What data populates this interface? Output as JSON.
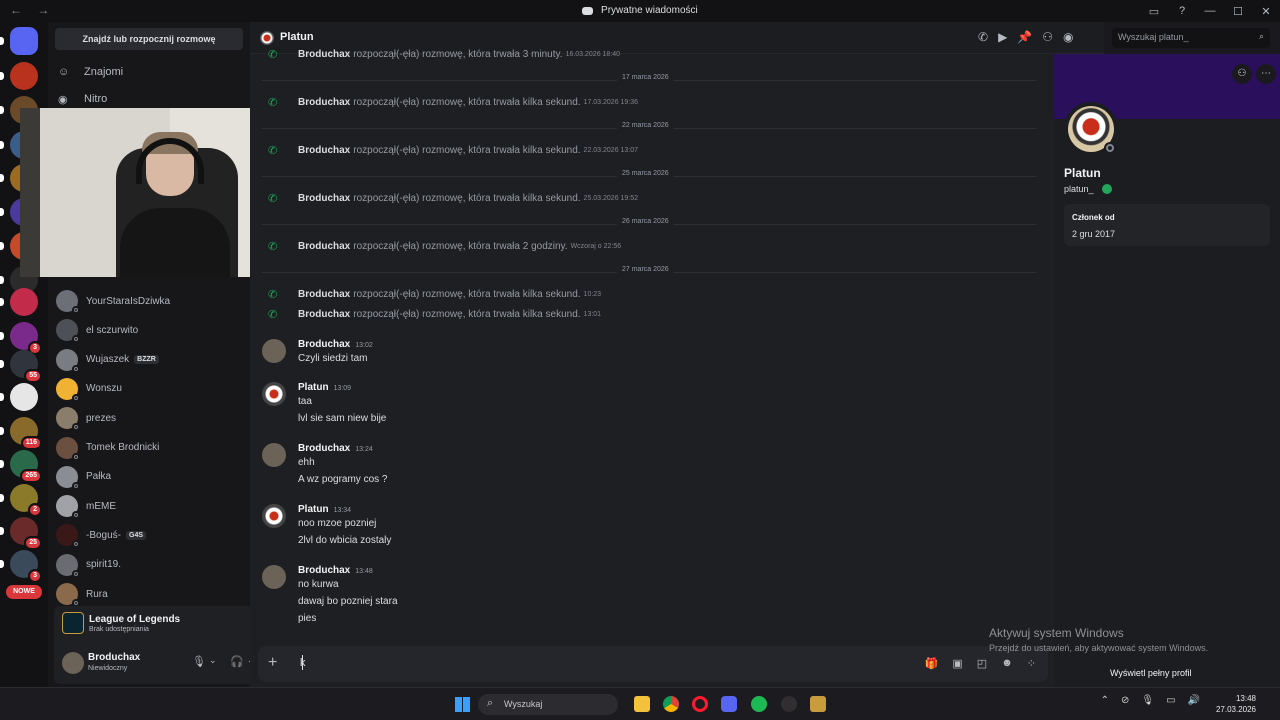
{
  "window": {
    "title": "Prywatne wiadomości",
    "nav_arrows": "← →",
    "minimize": "—",
    "maximize": "☐",
    "close": "✕"
  },
  "servers": [
    {
      "color": "#5865f2",
      "badge": ""
    },
    {
      "color": "#b8321e",
      "badge": ""
    },
    {
      "color": "#6b4a2a",
      "badge": ""
    },
    {
      "color": "#3a5d8a",
      "badge": ""
    },
    {
      "color": "#9a6b21",
      "badge": ""
    },
    {
      "color": "#4a3aa0",
      "badge": ""
    },
    {
      "color": "#c44a2a",
      "badge": ""
    },
    {
      "color": "#2b2b2b",
      "badge": ""
    },
    {
      "color": "#c22b4a",
      "badge": ""
    },
    {
      "color": "#7a2a8a",
      "badge": "3"
    },
    {
      "color": "#30353d",
      "badge": "55"
    },
    {
      "color": "#e6e6e6",
      "badge": ""
    },
    {
      "color": "#8a6a2a",
      "badge": "116"
    },
    {
      "color": "#2a6a4a",
      "badge": "265"
    },
    {
      "color": "#8a7a2a",
      "badge": "2"
    },
    {
      "color": "#6a2a2a",
      "badge": "25"
    },
    {
      "color": "#3a4a5a",
      "badge": "3"
    }
  ],
  "servers_new_label": "NOWE",
  "dm": {
    "search_placeholder": "Znajdź lub rozpocznij rozmowę",
    "nav": [
      {
        "label": "Znajomi",
        "icon": "friends-icon"
      },
      {
        "label": "Nitro",
        "icon": "nitro-icon"
      }
    ],
    "list": [
      {
        "name": "YourStaraIsDziwka",
        "tag": "",
        "color": "#6d6f78"
      },
      {
        "name": "el sczurwito",
        "tag": "",
        "color": "#4e5058"
      },
      {
        "name": "Wujaszek",
        "tag": "BZZR",
        "color": "#7a7c84"
      },
      {
        "name": "Wonszu",
        "tag": "",
        "color": "#f0b232"
      },
      {
        "name": "prezes",
        "tag": "",
        "color": "#8a7d6b"
      },
      {
        "name": "Tomek Brodnicki",
        "tag": "",
        "color": "#6b5040"
      },
      {
        "name": "Pałka",
        "tag": "",
        "color": "#8b8d94"
      },
      {
        "name": "mEME",
        "tag": "",
        "color": "#a0a2a8"
      },
      {
        "name": "-Boguś-",
        "tag": "G4S",
        "color": "#3a1818"
      },
      {
        "name": "spirit19.",
        "tag": "",
        "color": "#6a6c72"
      },
      {
        "name": "Rura",
        "tag": "",
        "color": "#8a6a4a"
      }
    ],
    "activity": {
      "game": "League of Legends",
      "status": "Brak udostępniania"
    },
    "user": {
      "name": "Broduchax",
      "status": "Niewidoczny"
    }
  },
  "chat": {
    "recipient": "Platun",
    "search_placeholder": "Wyszukaj platun_",
    "composer_value": "k",
    "top_call": {
      "name": "Broduchax",
      "text": "rozpoczął(-ęła) rozmowę, która trwała 3 minuty.",
      "time": "16.03.2026 18:40"
    },
    "blocks": [
      {
        "date": "17 marca 2026",
        "calls": [
          {
            "name": "Broduchax",
            "text": "rozpoczął(-ęła) rozmowę, która trwała kilka sekund.",
            "time": "17.03.2026 19:36"
          }
        ]
      },
      {
        "date": "22 marca 2026",
        "calls": [
          {
            "name": "Broduchax",
            "text": "rozpoczął(-ęła) rozmowę, która trwała kilka sekund.",
            "time": "22.03.2026 13:07"
          }
        ]
      },
      {
        "date": "25 marca 2026",
        "calls": [
          {
            "name": "Broduchax",
            "text": "rozpoczął(-ęła) rozmowę, która trwała kilka sekund.",
            "time": "25.03.2026 19:52"
          }
        ]
      },
      {
        "date": "26 marca 2026",
        "calls": [
          {
            "name": "Broduchax",
            "text": "rozpoczął(-ęła) rozmowę, która trwała 2 godziny.",
            "time": "Wczoraj o 22:56"
          }
        ]
      },
      {
        "date": "27 marca 2026",
        "calls": [
          {
            "name": "Broduchax",
            "text": "rozpoczął(-ęła) rozmowę, która trwała kilka sekund.",
            "time": "10:23"
          },
          {
            "name": "Broduchax",
            "text": "rozpoczął(-ęła) rozmowę, która trwała kilka sekund.",
            "time": "13:01"
          }
        ]
      }
    ],
    "messages": [
      {
        "author": "Broduchax",
        "time": "13:02",
        "lines": [
          "Czyli siedzi tam"
        ]
      },
      {
        "author": "Platun",
        "time": "13:09",
        "lines": [
          "taa",
          "lvl sie sam niew bije"
        ]
      },
      {
        "author": "Broduchax",
        "time": "13:24",
        "lines": [
          "ehh",
          "A wz pogramy cos ?"
        ]
      },
      {
        "author": "Platun",
        "time": "13:34",
        "lines": [
          "noo mzoe pozniej",
          "2lvl do wbicia zostaly"
        ]
      },
      {
        "author": "Broduchax",
        "time": "13:48",
        "lines": [
          "no kurwa",
          "dawaj bo pozniej stara",
          "pies"
        ]
      }
    ]
  },
  "profile": {
    "display_name": "Platun",
    "username": "platun_",
    "member_since_label": "Członek od",
    "member_since": "2 gru 2017",
    "full_profile": "Wyświetl pełny profil"
  },
  "watermark": {
    "title": "Aktywuj system Windows",
    "subtitle": "Przejdź do ustawień, aby aktywować system Windows."
  },
  "taskbar": {
    "search": "Wyszukaj",
    "time": "13:48",
    "date": "27.03.2026"
  },
  "colors": {
    "accent": "#5865f2",
    "online": "#23a55a",
    "banner": "#2a0f5c"
  }
}
